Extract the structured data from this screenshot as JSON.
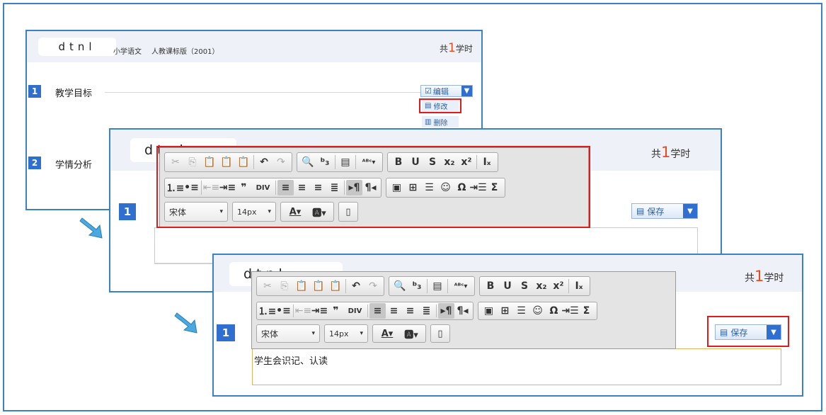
{
  "brand": "dtnl",
  "course": {
    "subject": "小学语文",
    "edition": "人教课标版（2001）"
  },
  "total": {
    "prefix": "共",
    "count": "1",
    "suffix": "学时"
  },
  "sections": [
    {
      "index": "1",
      "title": "教学目标"
    },
    {
      "index": "2",
      "title": "学情分析"
    }
  ],
  "menu": {
    "edit": "编辑",
    "modify": "修改",
    "delete": "删除"
  },
  "save_label": "保存",
  "toolbar": {
    "font_family": "宋体",
    "font_size": "14px",
    "row1_groups": [
      [
        {
          "n": "cut-icon",
          "g": "✂",
          "dis": true
        },
        {
          "n": "copy-icon",
          "g": "⎘",
          "dis": true
        },
        {
          "n": "paste-icon",
          "g": "📋"
        },
        {
          "n": "paste-text-icon",
          "g": "📋"
        },
        {
          "n": "paste-word-icon",
          "g": "📋"
        },
        {
          "n": "sep"
        },
        {
          "n": "undo-icon",
          "g": "↶"
        },
        {
          "n": "redo-icon",
          "g": "↷",
          "dis": true
        }
      ],
      [
        {
          "n": "find-icon",
          "g": "🔍"
        },
        {
          "n": "replace-icon",
          "g": "ᵇ₃"
        },
        {
          "n": "sep"
        },
        {
          "n": "select-all-icon",
          "g": "▤"
        },
        {
          "n": "sep"
        },
        {
          "n": "spellcheck-icon",
          "g": "ᴬᴮᶜ▾"
        }
      ],
      [
        {
          "n": "bold-icon",
          "g": "B"
        },
        {
          "n": "underline-icon",
          "g": "U"
        },
        {
          "n": "strike-icon",
          "g": "S"
        },
        {
          "n": "subscript-icon",
          "g": "x₂"
        },
        {
          "n": "superscript-icon",
          "g": "x²"
        },
        {
          "n": "sep"
        },
        {
          "n": "remove-format-icon",
          "g": "Iₓ"
        }
      ]
    ],
    "row2_groups": [
      [
        {
          "n": "numbered-list-icon",
          "g": "⒈≡"
        },
        {
          "n": "bullet-list-icon",
          "g": "•≡"
        },
        {
          "n": "sep"
        },
        {
          "n": "outdent-icon",
          "g": "⇤≡",
          "dis": true
        },
        {
          "n": "indent-icon",
          "g": "⇥≡"
        },
        {
          "n": "quote-icon",
          "g": "❞"
        },
        {
          "n": "div-icon",
          "g": "DIV"
        },
        {
          "n": "sep"
        },
        {
          "n": "align-left-icon",
          "g": "≡",
          "act": true
        },
        {
          "n": "align-center-icon",
          "g": "≡"
        },
        {
          "n": "align-right-icon",
          "g": "≡"
        },
        {
          "n": "justify-icon",
          "g": "≣"
        },
        {
          "n": "sep"
        },
        {
          "n": "ltr-icon",
          "g": "▸¶",
          "act": true
        },
        {
          "n": "rtl-icon",
          "g": "¶◂"
        }
      ],
      [
        {
          "n": "image-icon",
          "g": "▣"
        },
        {
          "n": "table-icon",
          "g": "⊞"
        },
        {
          "n": "hr-icon",
          "g": "☰"
        },
        {
          "n": "smiley-icon",
          "g": "☺"
        },
        {
          "n": "omega-icon",
          "g": "Ω"
        },
        {
          "n": "pagebreak-icon",
          "g": "⇥☰"
        },
        {
          "n": "sigma-icon",
          "g": "Σ"
        }
      ]
    ]
  },
  "editor_text": "学生会识记、认读"
}
